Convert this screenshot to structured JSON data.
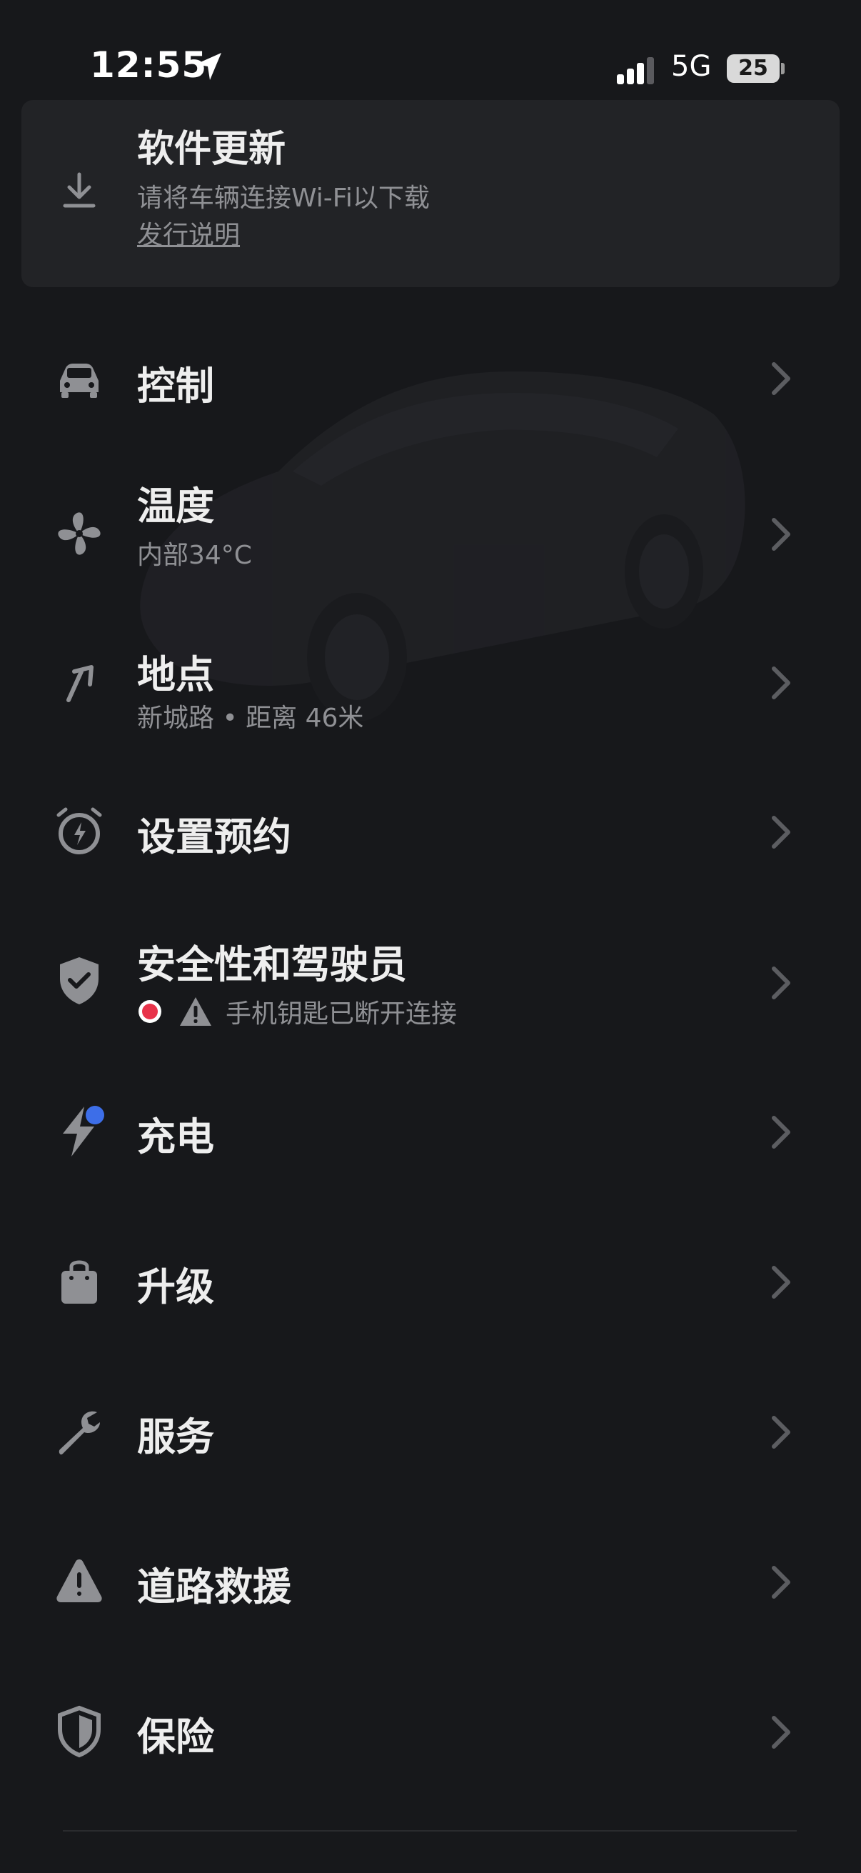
{
  "status_bar": {
    "time": "12:55",
    "network": "5G",
    "battery": "25"
  },
  "update_card": {
    "title": "软件更新",
    "subtitle": "请将车辆连接Wi-Fi以下载",
    "link": "发行说明"
  },
  "menu": {
    "controls": {
      "label": "控制"
    },
    "climate": {
      "label": "温度",
      "sub": "内部34°C"
    },
    "location": {
      "label": "地点",
      "sub": "新城路 • 距离 46米"
    },
    "schedule": {
      "label": "设置预约"
    },
    "security": {
      "label": "安全性和驾驶员",
      "status_text": "手机钥匙已断开连接"
    },
    "charging": {
      "label": "充电"
    },
    "upgrades": {
      "label": "升级"
    },
    "service": {
      "label": "服务"
    },
    "roadside": {
      "label": "道路救援"
    },
    "insurance": {
      "label": "保险"
    }
  },
  "colors": {
    "background": "#17181b",
    "card": "#222326",
    "text": "#eeeeee",
    "muted": "#8f9094",
    "alert_red": "#e8334a",
    "accent_blue": "#3d6ee8"
  },
  "icons": [
    "location-arrow-icon",
    "signal-icon",
    "battery-icon",
    "download-icon",
    "car-icon",
    "fan-icon",
    "navigation-arrow-icon",
    "alarm-clock-icon",
    "shield-check-icon",
    "warning-icon",
    "bolt-icon",
    "bag-icon",
    "wrench-icon",
    "road-warning-icon",
    "shield-icon",
    "chevron-right-icon"
  ]
}
